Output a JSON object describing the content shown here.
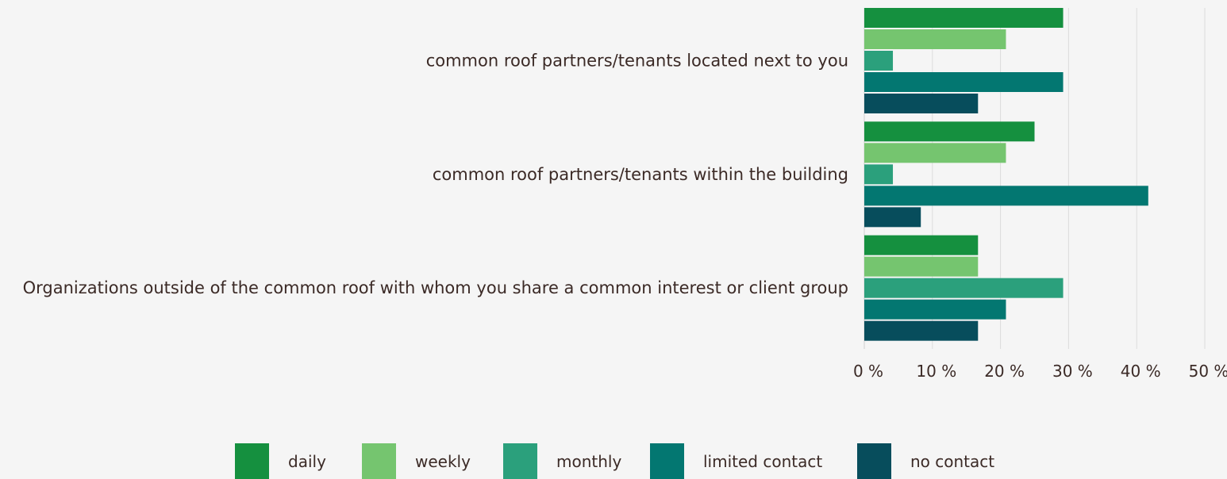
{
  "chart_data": {
    "type": "bar",
    "orientation": "horizontal",
    "categories": [
      "common roof partners/tenants located next to you",
      "common roof partners/tenants within the building",
      "Organizations outside of the common roof with whom you share a common interest or client group"
    ],
    "series": [
      {
        "name": "daily",
        "color": "#15903f",
        "values": [
          29.2,
          25.0,
          16.7
        ]
      },
      {
        "name": "weekly",
        "color": "#75c56f",
        "values": [
          20.8,
          20.8,
          16.7
        ]
      },
      {
        "name": "monthly",
        "color": "#2ba07c",
        "values": [
          4.2,
          4.2,
          29.2
        ]
      },
      {
        "name": "limited contact",
        "color": "#037771",
        "values": [
          29.2,
          41.7,
          20.8
        ]
      },
      {
        "name": "no contact",
        "color": "#074d5c",
        "values": [
          16.7,
          8.3,
          16.7
        ]
      }
    ],
    "xlim": [
      0,
      50
    ],
    "xticks": [
      "0 %",
      "10 %",
      "20 %",
      "30 %",
      "40 %",
      "50 %"
    ],
    "xtick_values": [
      0,
      10,
      20,
      30,
      40,
      50
    ],
    "grid": true,
    "legend_position": "bottom",
    "title": "",
    "xlabel": "",
    "ylabel": ""
  }
}
